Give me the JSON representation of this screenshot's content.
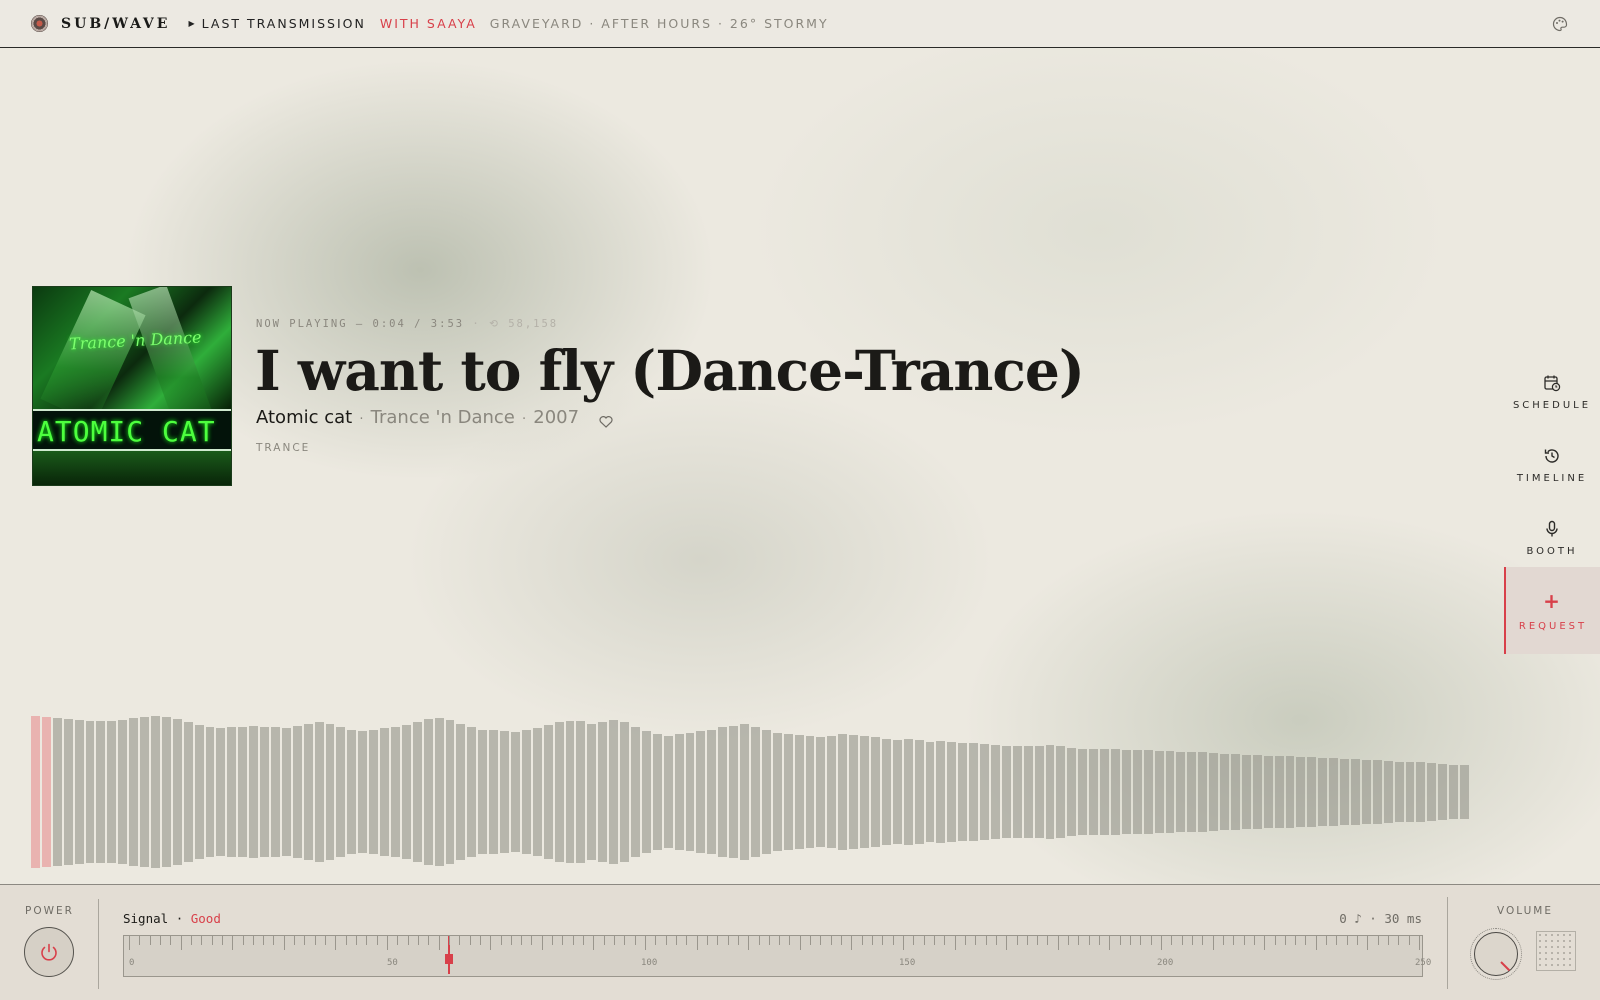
{
  "header": {
    "brand": "SUB/WAVE",
    "show_title": "LAST TRANSMISSION",
    "host": "WITH SAAYA",
    "meta": "GRAVEYARD · AFTER HOURS · 26° STORMY"
  },
  "now_playing": {
    "label": "NOW PLAYING —",
    "elapsed": "0:04",
    "duration": "3:53",
    "plays": "58,158",
    "title": "I want to fly (Dance-Trance)",
    "artist": "Atomic cat",
    "album": "Trance 'n Dance",
    "year": "2007",
    "genre": "TRANCE",
    "album_art": {
      "text_top": "Trance 'n Dance",
      "text_main": "ATOMIC CAT"
    }
  },
  "sidenav": {
    "items": [
      {
        "label": "SCHEDULE",
        "icon": "calendar-clock-icon"
      },
      {
        "label": "TIMELINE",
        "icon": "history-icon"
      },
      {
        "label": "BOOTH",
        "icon": "microphone-icon"
      }
    ],
    "request": {
      "label": "REQUEST",
      "icon": "plus-icon"
    }
  },
  "waveform": {
    "progress": 0.017,
    "levels": [
      1.0,
      0.99,
      0.98,
      0.96,
      0.95,
      0.94,
      0.93,
      0.93,
      0.95,
      0.97,
      0.99,
      1.0,
      0.99,
      0.96,
      0.92,
      0.88,
      0.85,
      0.84,
      0.85,
      0.86,
      0.87,
      0.86,
      0.85,
      0.84,
      0.87,
      0.9,
      0.92,
      0.9,
      0.86,
      0.82,
      0.8,
      0.81,
      0.84,
      0.86,
      0.88,
      0.92,
      0.96,
      0.98,
      0.95,
      0.9,
      0.85,
      0.82,
      0.81,
      0.8,
      0.79,
      0.81,
      0.84,
      0.88,
      0.92,
      0.94,
      0.93,
      0.9,
      0.92,
      0.95,
      0.92,
      0.86,
      0.8,
      0.76,
      0.74,
      0.76,
      0.78,
      0.8,
      0.82,
      0.85,
      0.87,
      0.9,
      0.86,
      0.82,
      0.78,
      0.76,
      0.75,
      0.74,
      0.73,
      0.74,
      0.76,
      0.75,
      0.74,
      0.72,
      0.7,
      0.69,
      0.7,
      0.68,
      0.66,
      0.67,
      0.66,
      0.65,
      0.64,
      0.63,
      0.62,
      0.61,
      0.61,
      0.6,
      0.61,
      0.62,
      0.6,
      0.58,
      0.57,
      0.57,
      0.56,
      0.56,
      0.55,
      0.55,
      0.55,
      0.54,
      0.54,
      0.53,
      0.52,
      0.52,
      0.51,
      0.5,
      0.5,
      0.49,
      0.49,
      0.48,
      0.48,
      0.47,
      0.46,
      0.46,
      0.45,
      0.45,
      0.44,
      0.43,
      0.42,
      0.42,
      0.41,
      0.4,
      0.4,
      0.39,
      0.38,
      0.37,
      0.36,
      0.35
    ]
  },
  "controls": {
    "power_label": "POWER",
    "signal_label": "Signal",
    "signal_sep": "·",
    "signal_status": "Good",
    "latency": "0 ♪ · 30 ms",
    "volume_label": "VOLUME",
    "volume_level": 0.7,
    "tuner": {
      "min": 0,
      "max": 250,
      "value": 62,
      "labels": [
        "0",
        "50",
        "100",
        "150",
        "200",
        "250"
      ]
    }
  },
  "colors": {
    "accent": "#d8404a",
    "text": "#1b1a17",
    "muted": "#8a877e",
    "background": "#ece9e0"
  }
}
